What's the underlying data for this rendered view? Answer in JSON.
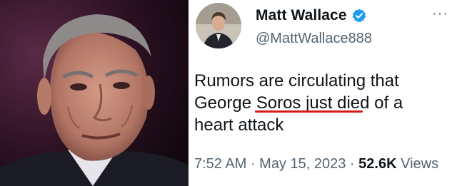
{
  "tweet": {
    "display_name": "Matt Wallace",
    "handle": "@MattWallace888",
    "more_label": "···",
    "verified_icon": "verified-badge-icon",
    "text_line1": "Rumors are circulating that",
    "text_line2_pre": "George ",
    "text_line2_highlight": "Soros just died",
    "text_line2_post": " of a",
    "text_line3": "heart attack",
    "time": "7:52 AM",
    "separator": " · ",
    "date": "May 15, 2023",
    "views_count": "52.6K",
    "views_label": "Views"
  },
  "colors": {
    "text": "#0f1419",
    "muted": "#536471",
    "verified": "#1d9bf0",
    "highlight_underline": "#d61a1a"
  }
}
